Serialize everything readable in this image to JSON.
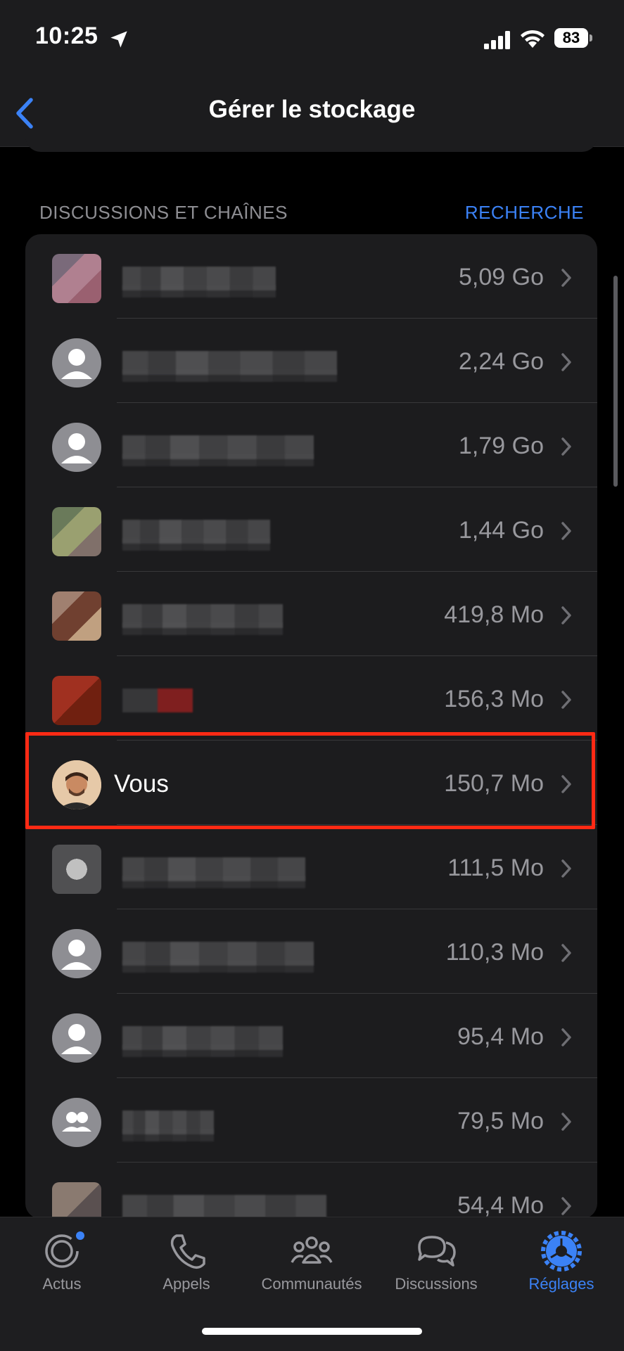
{
  "status_bar": {
    "time": "10:25",
    "battery": "83"
  },
  "nav": {
    "title": "Gérer le stockage"
  },
  "section": {
    "header": "DISCUSSIONS ET CHAÎNES",
    "action": "RECHERCHE"
  },
  "rows": [
    {
      "name": "",
      "size": "5,09 Go",
      "avatar": "blurred-photo"
    },
    {
      "name": "",
      "size": "2,24 Go",
      "avatar": "default-person"
    },
    {
      "name": "",
      "size": "1,79 Go",
      "avatar": "default-person"
    },
    {
      "name": "",
      "size": "1,44 Go",
      "avatar": "blurred-photo"
    },
    {
      "name": "",
      "size": "419,8 Mo",
      "avatar": "blurred-photo"
    },
    {
      "name": "",
      "size": "156,3 Mo",
      "avatar": "blurred-photo"
    },
    {
      "name": "Vous",
      "size": "150,7 Mo",
      "avatar": "user-photo"
    },
    {
      "name": "",
      "size": "111,5 Mo",
      "avatar": "blurred-photo"
    },
    {
      "name": "",
      "size": "110,3 Mo",
      "avatar": "default-person"
    },
    {
      "name": "",
      "size": "95,4 Mo",
      "avatar": "default-person"
    },
    {
      "name": "",
      "size": "79,5 Mo",
      "avatar": "default-group"
    },
    {
      "name": "",
      "size": "54,4 Mo",
      "avatar": "blurred-photo"
    }
  ],
  "tabs": [
    {
      "label": "Actus",
      "icon": "updates-icon"
    },
    {
      "label": "Appels",
      "icon": "phone-icon"
    },
    {
      "label": "Communautés",
      "icon": "communities-icon"
    },
    {
      "label": "Discussions",
      "icon": "chats-icon"
    },
    {
      "label": "Réglages",
      "icon": "settings-gear-icon"
    }
  ],
  "colors": {
    "accent": "#3b82f6",
    "highlight": "#ff2a14",
    "background": "#000000",
    "card": "#1c1c1e"
  }
}
